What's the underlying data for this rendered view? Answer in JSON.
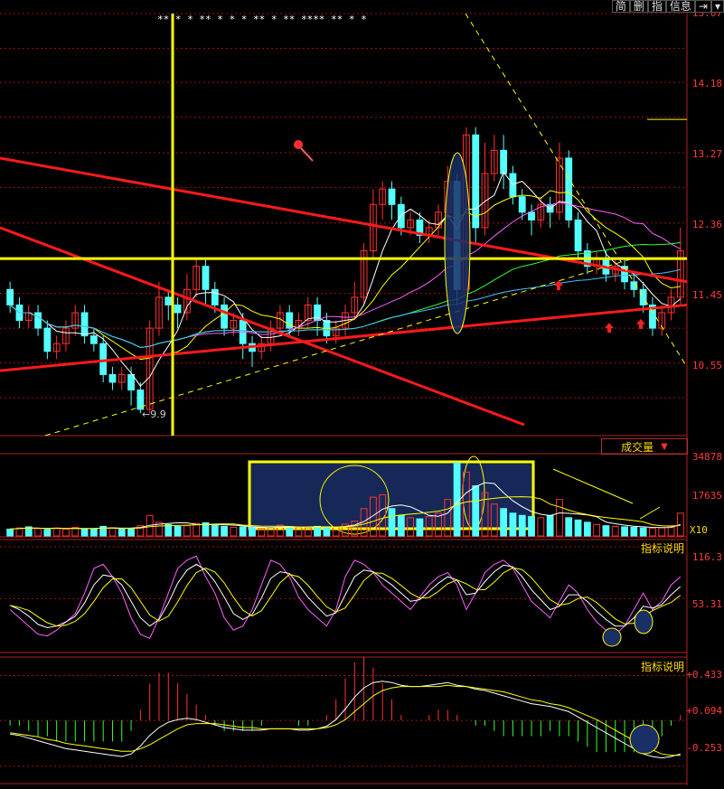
{
  "toolbar": {
    "buttons": [
      "简",
      "删",
      "指",
      "信息"
    ],
    "nav_icon": "exit-icon",
    "dropdown_icon": "chevron-down-icon"
  },
  "colors": {
    "background": "#000000",
    "up_candle": "#ff3030",
    "down_candle": "#54ffff",
    "grid": "#a01010",
    "axis_text": "#ff3b3b",
    "ma_white": "#ffffff",
    "ma_yellow": "#ffff00",
    "ma_magenta": "#ff60ff",
    "ma_green": "#33ff33",
    "ma_cyan": "#40c0ff",
    "trend_red": "#ff1a1a",
    "highlight_yellow": "#ffff00",
    "annotation_fill": "#1a2f66"
  },
  "chart_data": [
    {
      "type": "candlestick",
      "panel": "price",
      "y_ticks": [
        "15.07",
        "14.18",
        "13.27",
        "12.36",
        "11.45",
        "10.55"
      ],
      "ylim": [
        9.75,
        15.07
      ],
      "low_label": "9.9",
      "star_markers": "**  *  *   ** *   *  *  **   *   **   ****  **  *  *",
      "candles": [
        {
          "o": 11.5,
          "c": 11.3,
          "h": 11.6,
          "l": 11.2
        },
        {
          "o": 11.3,
          "c": 11.1,
          "h": 11.4,
          "l": 11.0
        },
        {
          "o": 11.1,
          "c": 11.2,
          "h": 11.3,
          "l": 11.0
        },
        {
          "o": 11.2,
          "c": 11.0,
          "h": 11.3,
          "l": 10.9
        },
        {
          "o": 11.0,
          "c": 10.7,
          "h": 11.1,
          "l": 10.6
        },
        {
          "o": 10.7,
          "c": 10.8,
          "h": 10.9,
          "l": 10.6
        },
        {
          "o": 10.8,
          "c": 11.0,
          "h": 11.1,
          "l": 10.7
        },
        {
          "o": 11.0,
          "c": 11.2,
          "h": 11.3,
          "l": 10.9
        },
        {
          "o": 11.2,
          "c": 10.9,
          "h": 11.3,
          "l": 10.8
        },
        {
          "o": 10.9,
          "c": 10.8,
          "h": 11.0,
          "l": 10.7
        },
        {
          "o": 10.8,
          "c": 10.4,
          "h": 10.9,
          "l": 10.3
        },
        {
          "o": 10.4,
          "c": 10.3,
          "h": 10.5,
          "l": 10.2
        },
        {
          "o": 10.3,
          "c": 10.4,
          "h": 10.5,
          "l": 10.2
        },
        {
          "o": 10.4,
          "c": 10.2,
          "h": 10.5,
          "l": 10.0
        },
        {
          "o": 10.2,
          "c": 9.95,
          "h": 10.3,
          "l": 9.9
        },
        {
          "o": 9.95,
          "c": 11.0,
          "h": 11.1,
          "l": 9.9
        },
        {
          "o": 11.0,
          "c": 11.4,
          "h": 11.6,
          "l": 10.9
        },
        {
          "o": 11.4,
          "c": 11.3,
          "h": 11.5,
          "l": 11.1
        },
        {
          "o": 11.3,
          "c": 11.2,
          "h": 11.4,
          "l": 11.0
        },
        {
          "o": 11.2,
          "c": 11.5,
          "h": 11.7,
          "l": 11.1
        },
        {
          "o": 11.5,
          "c": 11.8,
          "h": 11.9,
          "l": 11.4
        },
        {
          "o": 11.8,
          "c": 11.5,
          "h": 11.9,
          "l": 11.3
        },
        {
          "o": 11.5,
          "c": 11.3,
          "h": 11.6,
          "l": 11.2
        },
        {
          "o": 11.3,
          "c": 11.0,
          "h": 11.4,
          "l": 10.9
        },
        {
          "o": 11.0,
          "c": 11.1,
          "h": 11.2,
          "l": 10.9
        },
        {
          "o": 11.1,
          "c": 10.8,
          "h": 11.2,
          "l": 10.6
        },
        {
          "o": 10.8,
          "c": 10.7,
          "h": 10.9,
          "l": 10.5
        },
        {
          "o": 10.7,
          "c": 10.8,
          "h": 10.9,
          "l": 10.6
        },
        {
          "o": 10.8,
          "c": 11.0,
          "h": 11.1,
          "l": 10.7
        },
        {
          "o": 11.0,
          "c": 11.2,
          "h": 11.3,
          "l": 10.9
        },
        {
          "o": 11.2,
          "c": 11.0,
          "h": 11.3,
          "l": 10.9
        },
        {
          "o": 11.0,
          "c": 11.1,
          "h": 11.2,
          "l": 10.9
        },
        {
          "o": 11.1,
          "c": 11.3,
          "h": 11.4,
          "l": 11.0
        },
        {
          "o": 11.3,
          "c": 11.1,
          "h": 11.4,
          "l": 10.9
        },
        {
          "o": 11.1,
          "c": 10.9,
          "h": 11.2,
          "l": 10.8
        },
        {
          "o": 10.9,
          "c": 11.0,
          "h": 11.1,
          "l": 10.8
        },
        {
          "o": 11.0,
          "c": 11.2,
          "h": 11.3,
          "l": 10.9
        },
        {
          "o": 11.2,
          "c": 11.4,
          "h": 11.6,
          "l": 11.1
        },
        {
          "o": 11.4,
          "c": 12.0,
          "h": 12.1,
          "l": 11.3
        },
        {
          "o": 12.0,
          "c": 12.6,
          "h": 12.8,
          "l": 11.9
        },
        {
          "o": 12.6,
          "c": 12.8,
          "h": 12.9,
          "l": 12.4
        },
        {
          "o": 12.8,
          "c": 12.6,
          "h": 12.9,
          "l": 12.4
        },
        {
          "o": 12.6,
          "c": 12.3,
          "h": 12.7,
          "l": 12.2
        },
        {
          "o": 12.3,
          "c": 12.4,
          "h": 12.5,
          "l": 12.2
        },
        {
          "o": 12.4,
          "c": 12.2,
          "h": 12.5,
          "l": 12.1
        },
        {
          "o": 12.2,
          "c": 12.3,
          "h": 12.4,
          "l": 12.1
        },
        {
          "o": 12.3,
          "c": 12.5,
          "h": 12.6,
          "l": 12.2
        },
        {
          "o": 12.5,
          "c": 12.9,
          "h": 13.1,
          "l": 12.4
        },
        {
          "o": 12.9,
          "c": 11.5,
          "h": 13.0,
          "l": 11.3
        },
        {
          "o": 11.5,
          "c": 13.5,
          "h": 13.6,
          "l": 11.4
        },
        {
          "o": 13.5,
          "c": 12.3,
          "h": 13.6,
          "l": 12.1
        },
        {
          "o": 12.3,
          "c": 13.0,
          "h": 13.4,
          "l": 12.2
        },
        {
          "o": 13.0,
          "c": 13.3,
          "h": 13.5,
          "l": 12.9
        },
        {
          "o": 13.3,
          "c": 13.0,
          "h": 13.5,
          "l": 12.8
        },
        {
          "o": 13.0,
          "c": 12.7,
          "h": 13.1,
          "l": 12.6
        },
        {
          "o": 12.7,
          "c": 12.5,
          "h": 12.8,
          "l": 12.4
        },
        {
          "o": 12.5,
          "c": 12.4,
          "h": 12.6,
          "l": 12.2
        },
        {
          "o": 12.4,
          "c": 12.6,
          "h": 12.7,
          "l": 12.3
        },
        {
          "o": 12.6,
          "c": 12.5,
          "h": 12.7,
          "l": 12.3
        },
        {
          "o": 12.5,
          "c": 13.2,
          "h": 13.4,
          "l": 12.4
        },
        {
          "o": 13.2,
          "c": 12.4,
          "h": 13.3,
          "l": 12.3
        },
        {
          "o": 12.4,
          "c": 12.0,
          "h": 12.5,
          "l": 11.9
        },
        {
          "o": 12.0,
          "c": 11.8,
          "h": 12.1,
          "l": 11.7
        },
        {
          "o": 11.8,
          "c": 11.9,
          "h": 12.0,
          "l": 11.7
        },
        {
          "o": 11.9,
          "c": 11.7,
          "h": 12.0,
          "l": 11.6
        },
        {
          "o": 11.7,
          "c": 11.8,
          "h": 11.9,
          "l": 11.6
        },
        {
          "o": 11.8,
          "c": 11.6,
          "h": 11.9,
          "l": 11.5
        },
        {
          "o": 11.6,
          "c": 11.5,
          "h": 11.7,
          "l": 11.4
        },
        {
          "o": 11.5,
          "c": 11.3,
          "h": 11.6,
          "l": 11.2
        },
        {
          "o": 11.3,
          "c": 11.0,
          "h": 11.4,
          "l": 10.9
        },
        {
          "o": 11.0,
          "c": 11.2,
          "h": 11.3,
          "l": 10.9
        },
        {
          "o": 11.2,
          "c": 11.4,
          "h": 11.5,
          "l": 11.1
        },
        {
          "o": 11.4,
          "c": 12.0,
          "h": 12.3,
          "l": 11.3
        }
      ]
    },
    {
      "type": "bar",
      "panel": "volume",
      "label": "成交量",
      "y_ticks": [
        "34878",
        "17635"
      ],
      "ylim": [
        0,
        34878
      ],
      "unit": "X10",
      "values": [
        3000,
        3500,
        4000,
        3200,
        2800,
        3500,
        3000,
        3800,
        2900,
        3100,
        4200,
        3600,
        3300,
        3000,
        4500,
        9000,
        6000,
        5000,
        4200,
        4500,
        5500,
        5800,
        4500,
        4200,
        3800,
        4000,
        3600,
        3200,
        3500,
        4800,
        4100,
        3700,
        3600,
        4200,
        4000,
        3900,
        5200,
        6500,
        12000,
        17000,
        18000,
        12000,
        9000,
        8000,
        7500,
        8500,
        10000,
        16000,
        32000,
        28000,
        22000,
        19000,
        14000,
        12000,
        10000,
        9000,
        8500,
        8000,
        9000,
        16000,
        8000,
        7000,
        6000,
        5000,
        4500,
        4200,
        4000,
        3800,
        3500,
        3300,
        3600,
        4500,
        10000
      ],
      "up_flags": [
        0,
        1,
        0,
        1,
        0,
        1,
        1,
        1,
        0,
        0,
        0,
        1,
        0,
        0,
        1,
        1,
        1,
        0,
        0,
        1,
        1,
        0,
        0,
        0,
        1,
        0,
        0,
        1,
        1,
        1,
        0,
        1,
        1,
        0,
        0,
        1,
        1,
        1,
        1,
        1,
        1,
        0,
        0,
        1,
        0,
        1,
        1,
        1,
        0,
        1,
        0,
        1,
        1,
        0,
        0,
        0,
        0,
        1,
        0,
        1,
        0,
        0,
        0,
        1,
        0,
        1,
        0,
        0,
        0,
        1,
        1,
        1,
        1
      ]
    },
    {
      "type": "line",
      "panel": "kdj",
      "label": "指标说明",
      "y_ticks": [
        "116.3",
        "53.31"
      ],
      "ylim": [
        -10,
        116.3
      ],
      "series": [
        {
          "values": [
            40,
            30,
            20,
            10,
            8,
            15,
            25,
            35,
            60,
            90,
            95,
            80,
            60,
            30,
            10,
            5,
            30,
            60,
            90,
            100,
            105,
            80,
            60,
            30,
            15,
            20,
            40,
            70,
            100,
            95,
            80,
            55,
            40,
            30,
            20,
            40,
            80,
            100,
            95,
            85,
            70,
            60,
            50,
            40,
            55,
            70,
            80,
            85,
            70,
            40,
            60,
            85,
            95,
            100,
            90,
            70,
            50,
            40,
            30,
            50,
            70,
            60,
            40,
            25,
            15,
            10,
            20,
            40,
            60,
            40,
            50,
            70,
            80
          ]
        },
        {
          "values": [
            45,
            40,
            32,
            22,
            18,
            20,
            25,
            32,
            48,
            70,
            82,
            80,
            70,
            50,
            30,
            20,
            28,
            48,
            72,
            88,
            95,
            88,
            74,
            55,
            35,
            28,
            34,
            54,
            78,
            86,
            84,
            70,
            55,
            43,
            32,
            36,
            58,
            80,
            88,
            86,
            78,
            70,
            60,
            50,
            52,
            62,
            72,
            80,
            76,
            58,
            60,
            74,
            86,
            94,
            92,
            80,
            64,
            52,
            40,
            44,
            58,
            58,
            50,
            38,
            28,
            20,
            20,
            30,
            44,
            42,
            46,
            58,
            68
          ]
        }
      ]
    },
    {
      "type": "line",
      "panel": "macd",
      "label": "指标说明",
      "y_ticks": [
        "+0.433",
        "+0.094",
        "-0.253"
      ],
      "ylim": [
        -0.35,
        0.45
      ],
      "series": [
        {
          "values": [
            -0.01,
            -0.02,
            -0.04,
            -0.06,
            -0.08,
            -0.1,
            -0.12,
            -0.13,
            -0.14,
            -0.15,
            -0.16,
            -0.17,
            -0.18,
            -0.16,
            -0.1,
            -0.02,
            0.04,
            0.08,
            0.1,
            0.11,
            0.1,
            0.08,
            0.06,
            0.04,
            0.03,
            0.02,
            0.02,
            0.02,
            0.03,
            0.03,
            0.03,
            0.02,
            0.02,
            0.03,
            0.05,
            0.1,
            0.18,
            0.27,
            0.34,
            0.38,
            0.39,
            0.38,
            0.36,
            0.35,
            0.35,
            0.36,
            0.37,
            0.38,
            0.36,
            0.35,
            0.33,
            0.32,
            0.3,
            0.28,
            0.26,
            0.24,
            0.22,
            0.21,
            0.2,
            0.18,
            0.16,
            0.12,
            0.08,
            0.04,
            0.0,
            -0.04,
            -0.08,
            -0.12,
            -0.16,
            -0.18,
            -0.19,
            -0.18,
            -0.16
          ]
        },
        {
          "values": [
            0.0,
            -0.01,
            -0.02,
            -0.03,
            -0.05,
            -0.06,
            -0.08,
            -0.09,
            -0.1,
            -0.11,
            -0.12,
            -0.13,
            -0.14,
            -0.14,
            -0.12,
            -0.09,
            -0.05,
            -0.01,
            0.03,
            0.06,
            0.07,
            0.07,
            0.07,
            0.06,
            0.05,
            0.04,
            0.04,
            0.03,
            0.03,
            0.03,
            0.03,
            0.03,
            0.03,
            0.03,
            0.04,
            0.06,
            0.1,
            0.16,
            0.22,
            0.28,
            0.32,
            0.34,
            0.35,
            0.35,
            0.35,
            0.35,
            0.35,
            0.36,
            0.35,
            0.35,
            0.34,
            0.33,
            0.32,
            0.31,
            0.29,
            0.27,
            0.25,
            0.24,
            0.22,
            0.21,
            0.19,
            0.16,
            0.13,
            0.1,
            0.06,
            0.02,
            -0.02,
            -0.06,
            -0.1,
            -0.13,
            -0.16,
            -0.17,
            -0.17
          ]
        }
      ]
    }
  ]
}
